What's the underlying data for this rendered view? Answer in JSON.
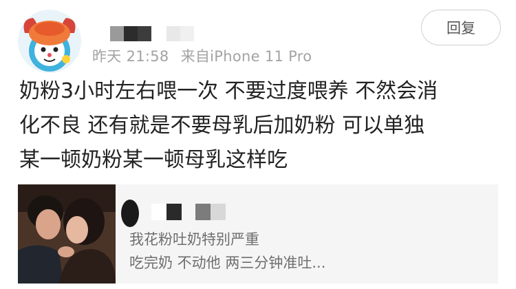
{
  "post": {
    "time": "昨天 21:58",
    "source": "来自iPhone 11 Pro",
    "content": "奶粉3小时左右喂一次 不要过度喂养 不然会消\n化不良 还有就是不要母乳后加奶粉 可以单独\n某一顿奶粉某一顿母乳这样吃"
  },
  "actions": {
    "reply_label": "回复"
  },
  "quoted": {
    "line1": "我花粉吐奶特别严重",
    "line2": "吃完奶 不动他 两三分钟准吐..."
  },
  "icons": {
    "avatar": "cartoon-mouse-avatar",
    "username": "pixelated-username",
    "thumbnail": "couple-photo-thumbnail"
  }
}
